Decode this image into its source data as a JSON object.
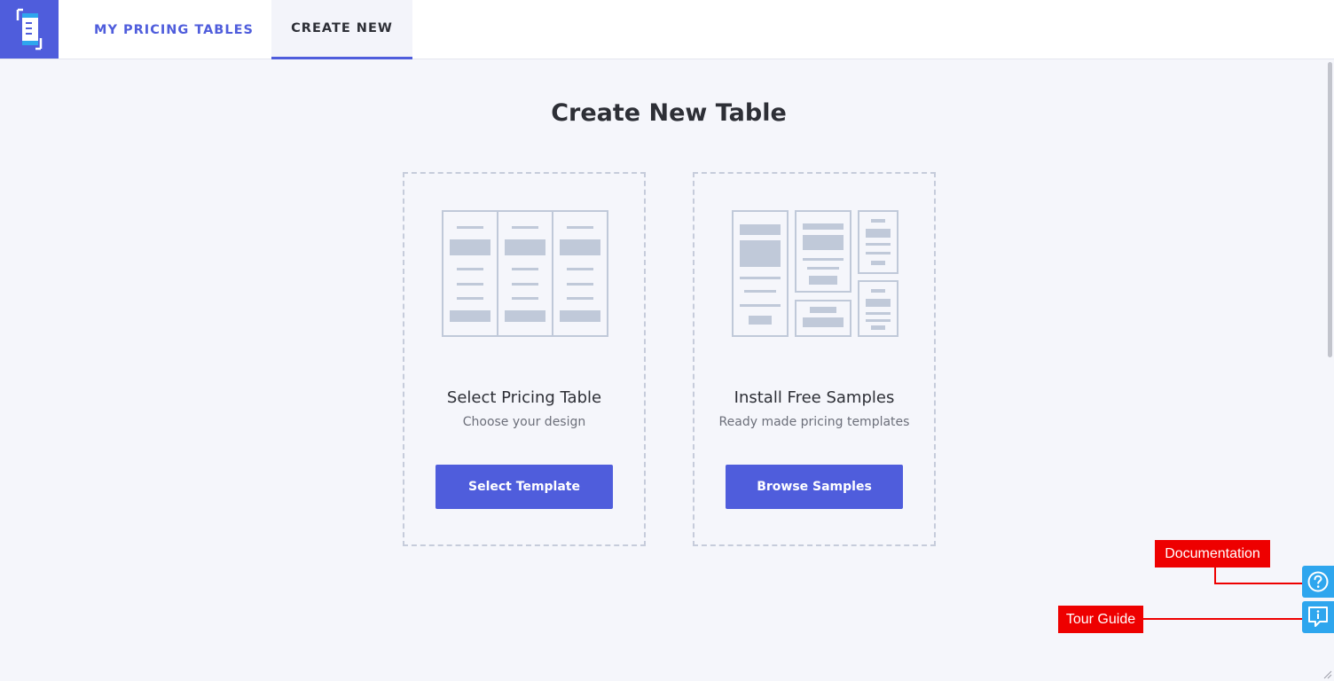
{
  "nav": {
    "logo_icon": "pricing-table-logo-icon",
    "tabs": [
      {
        "label": "MY PRICING TABLES",
        "active": false
      },
      {
        "label": "CREATE NEW",
        "active": true
      }
    ]
  },
  "main": {
    "title": "Create New Table",
    "cards": [
      {
        "icon": "pricing-columns-illustration",
        "title": "Select Pricing Table",
        "subtitle": "Choose your design",
        "button": "Select Template"
      },
      {
        "icon": "samples-grid-illustration",
        "title": "Install Free Samples",
        "subtitle": "Ready made pricing templates",
        "button": "Browse Samples"
      }
    ]
  },
  "side": {
    "documentation_icon": "question-circle-icon",
    "tour_icon": "info-chat-icon"
  },
  "callouts": {
    "documentation": "Documentation",
    "tour": "Tour Guide"
  },
  "colors": {
    "accent": "#4f5ddc",
    "side_button": "#2ea6ee",
    "callout": "#ee0000",
    "background": "#f5f6fb",
    "illustration": "#c0c9d9"
  }
}
